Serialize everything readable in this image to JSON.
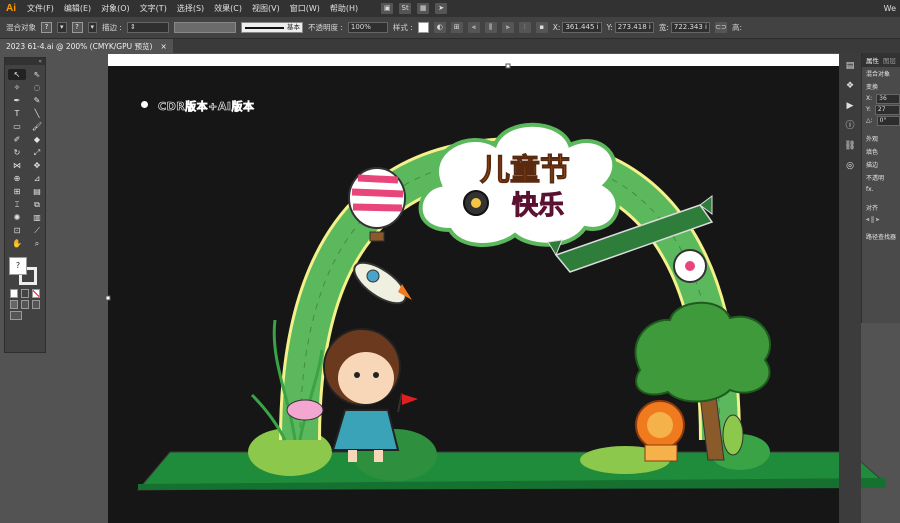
{
  "app": {
    "logo": "Ai",
    "right_text": "We"
  },
  "menu": {
    "items": [
      "文件(F)",
      "编辑(E)",
      "对象(O)",
      "文字(T)",
      "选择(S)",
      "效果(C)",
      "视图(V)",
      "窗口(W)",
      "帮助(H)"
    ]
  },
  "control_bar": {
    "mixed_objects": "混合对象",
    "stroke_label": "描边 :",
    "stroke_style": "基本",
    "opacity_label": "不透明度 :",
    "opacity_value": "100%",
    "style_label": "样式 :",
    "x_label": "X:",
    "x_value": "361.445 i",
    "y_label": "Y:",
    "y_value": "273.418 i",
    "w_label": "宽:",
    "w_value": "722.343 i",
    "h_label": "高:"
  },
  "document": {
    "tab_title": "2023 61-4.ai @ 200% (CMYK/GPU 预览)",
    "close": "×"
  },
  "panel": {
    "tabs": [
      "属性",
      "图层"
    ],
    "mixed_objects": "混合对象",
    "transform": "变换",
    "x_label": "X:",
    "x_value": "36",
    "y_label": "Y:",
    "y_value": "27",
    "angle_label": "△:",
    "angle_value": "0°",
    "appearance": "外观",
    "fill_label": "填色",
    "stroke_label": "描边",
    "opacity_label": "不透明",
    "fx_label": "fx.",
    "align": "对齐",
    "pathfinder": "路径查找器"
  },
  "artwork": {
    "cdr_label": "CDR版本+AI版本",
    "title_line1": "儿童节",
    "title_line2": "快乐"
  },
  "colors": {
    "artboard_bg": "#161616",
    "grass": "#1e8c3a",
    "arch": "#5cb85c",
    "arch_inner": "#d9e86a",
    "title_orange": "#f07a1e",
    "title_pink": "#e23c7a",
    "tree": "#3e9a3a",
    "trunk": "#8a5a2a"
  }
}
